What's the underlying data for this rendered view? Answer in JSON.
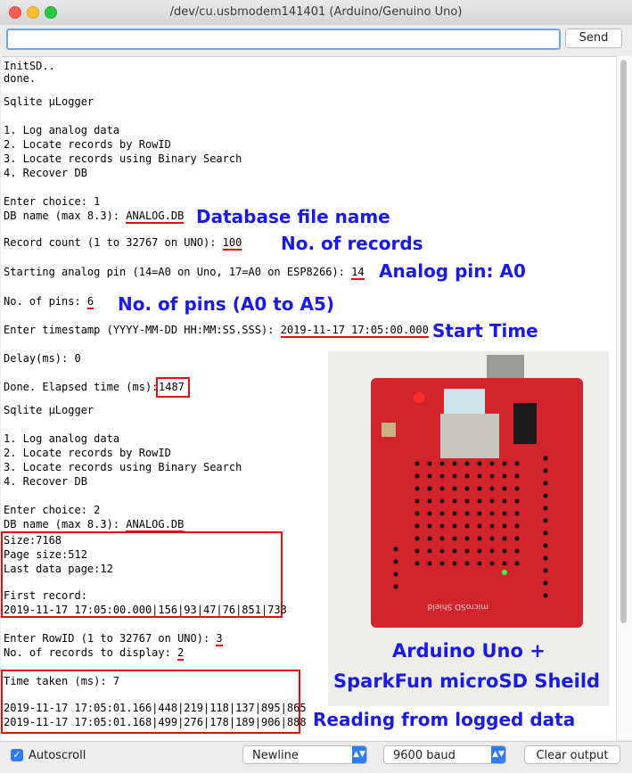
{
  "window": {
    "title": "/dev/cu.usbmodem141401 (Arduino/Genuino Uno)"
  },
  "input": {
    "value": "",
    "send_label": "Send"
  },
  "console": {
    "lines": [
      "InitSD..",
      "done.",
      "Sqlite µLogger",
      "1. Log analog data",
      "2. Locate records by RowID",
      "3. Locate records using Binary Search",
      "4. Recover DB",
      "Enter choice: 1",
      "DB name (max 8.3): ",
      "ANALOG.DB",
      "Record count (1 to 32767 on UNO): ",
      "100",
      "Starting analog pin (14=A0 on Uno, 17=A0 on ESP8266): ",
      "14",
      "No. of pins: ",
      "6",
      "Enter timestamp (YYYY-MM-DD HH:MM:SS.SSS): ",
      "2019-11-17 17:05:00.000",
      "Delay(ms): 0",
      "Done. Elapsed time (ms): ",
      "1487",
      "Sqlite µLogger",
      "1. Log analog data",
      "2. Locate records by RowID",
      "3. Locate records using Binary Search",
      "4. Recover DB",
      "Enter choice: 2",
      "DB name (max 8.3): ",
      "ANALOG.DB",
      "Size:7168",
      "Page size:512",
      "Last data page:12",
      "First record:",
      "2019-11-17 17:05:00.000|156|93|47|76|851|733",
      "Enter RowID (1 to 32767 on UNO): ",
      "3",
      "No. of records to display: ",
      "2",
      "Time taken (ms): 7",
      "2019-11-17 17:05:01.166|448|219|118|137|895|865",
      "2019-11-17 17:05:01.168|499|276|178|189|906|888"
    ]
  },
  "annotations": {
    "db_file_name": "Database file name",
    "no_of_records": "No. of records",
    "analog_pin": "Analog pin: A0",
    "no_of_pins": "No. of pins (A0 to A5)",
    "start_time": "Start Time",
    "reading": "Reading from logged data"
  },
  "photo": {
    "caption_line1": "Arduino Uno +",
    "caption_line2": "SparkFun microSD Sheild",
    "board_label": "microSD Shield"
  },
  "bottom": {
    "autoscroll_label": "Autoscroll",
    "autoscroll_checked": true,
    "line_ending": "Newline",
    "baud": "9600 baud",
    "clear_label": "Clear output"
  },
  "colors": {
    "annotation": "#1a1ae6",
    "highlight": "#e01010",
    "accent": "#2f7cf6"
  }
}
